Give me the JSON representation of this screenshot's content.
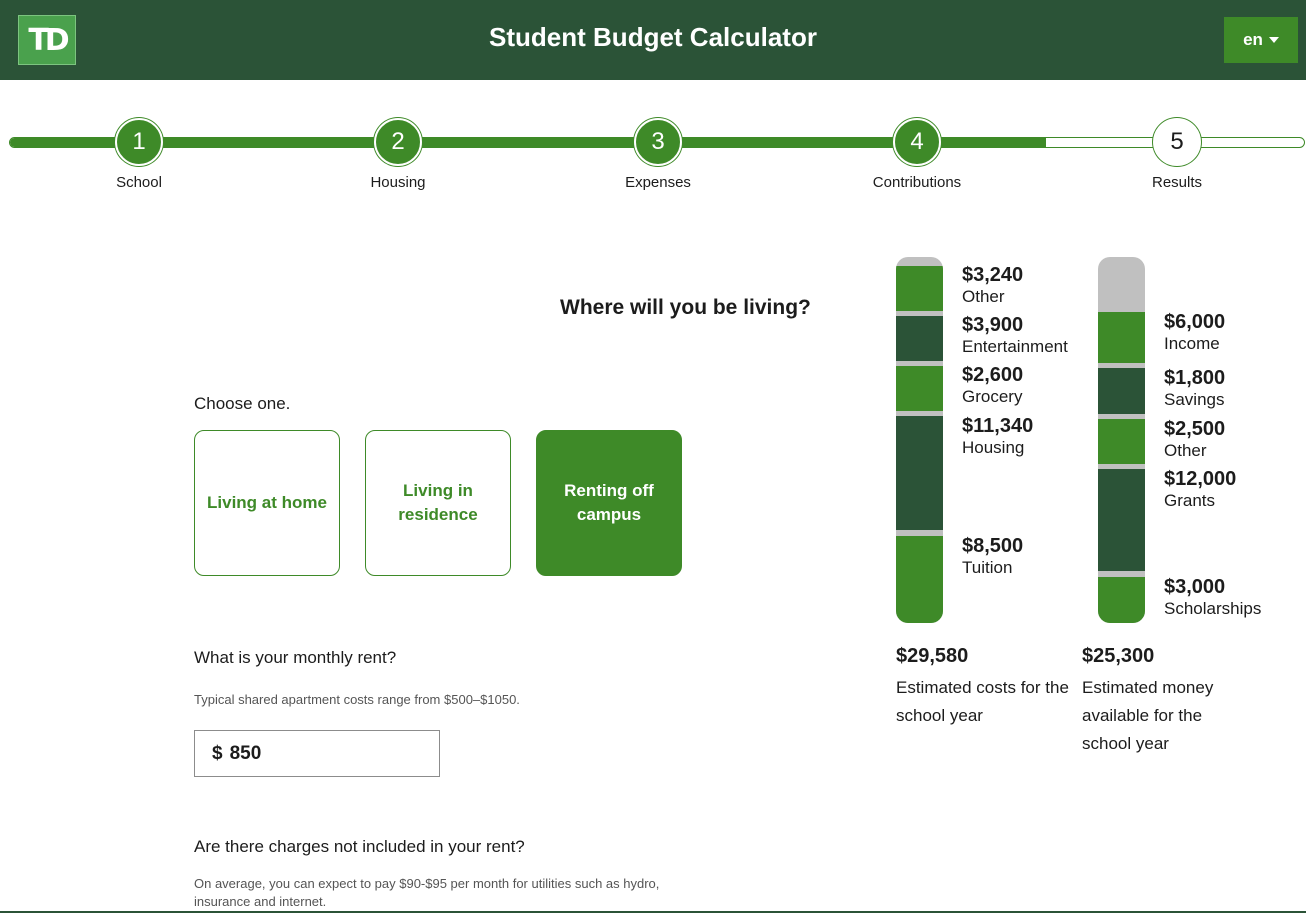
{
  "header": {
    "logo_text": "TD",
    "title": "Student Budget Calculator",
    "language": "en"
  },
  "steps": [
    {
      "number": "1",
      "label": "School",
      "state": "done"
    },
    {
      "number": "2",
      "label": "Housing",
      "state": "done"
    },
    {
      "number": "3",
      "label": "Expenses",
      "state": "done"
    },
    {
      "number": "4",
      "label": "Contributions",
      "state": "done"
    },
    {
      "number": "5",
      "label": "Results",
      "state": "pending"
    }
  ],
  "main": {
    "question": "Where will you be living?",
    "choose": "Choose one.",
    "options": [
      {
        "label": "Living at home",
        "selected": false
      },
      {
        "label": "Living in residence",
        "selected": false
      },
      {
        "label": "Renting off campus",
        "selected": true
      }
    ],
    "rent_question": "What is your monthly rent?",
    "rent_hint": "Typical shared apartment costs range from $500–$1050.",
    "rent_currency": "$",
    "rent_value": "850",
    "charges_question": "Are there charges not included in your rent?",
    "charges_hint": "On average, you can expect to pay $90-$95 per month for utilities such as hydro, insurance and internet."
  },
  "costs": {
    "items": [
      {
        "amount": "$3,240",
        "label": "Other",
        "color": "#3e8a28"
      },
      {
        "amount": "$3,900",
        "label": "Entertainment",
        "color": "#2b5337"
      },
      {
        "amount": "$2,600",
        "label": "Grocery",
        "color": "#3e8a28"
      },
      {
        "amount": "$11,340",
        "label": "Housing",
        "color": "#2b5337"
      },
      {
        "amount": "$8,500",
        "label": "Tuition",
        "color": "#3e8a28"
      }
    ],
    "total": "$29,580",
    "description": "Estimated costs for the school year"
  },
  "funds": {
    "items": [
      {
        "amount": "$6,000",
        "label": "Income",
        "color": "#3e8a28"
      },
      {
        "amount": "$1,800",
        "label": "Savings",
        "color": "#2b5337"
      },
      {
        "amount": "$2,500",
        "label": "Other",
        "color": "#3e8a28"
      },
      {
        "amount": "$12,000",
        "label": "Grants",
        "color": "#2b5337"
      },
      {
        "amount": "$3,000",
        "label": "Scholarships",
        "color": "#3e8a28"
      }
    ],
    "total": "$25,300",
    "description": "Estimated money available for the school year"
  },
  "colors": {
    "brand_dark": "#2b5337",
    "brand_green": "#3e8a28",
    "bar_remainder": "#c0c0c0"
  }
}
